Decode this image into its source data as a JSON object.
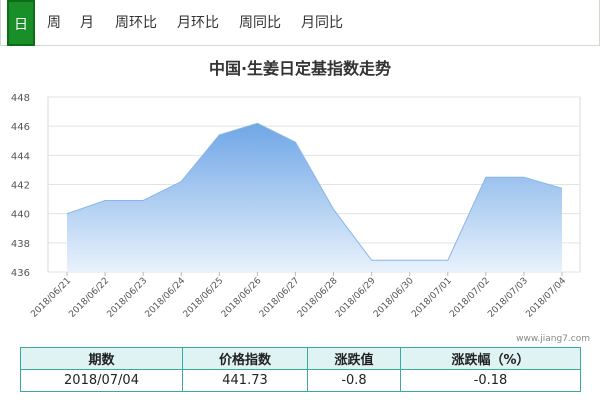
{
  "tabs": [
    {
      "label": "日",
      "active": true
    },
    {
      "label": "周",
      "active": false
    },
    {
      "label": "月",
      "active": false
    },
    {
      "label": "周环比",
      "active": false
    },
    {
      "label": "月环比",
      "active": false
    },
    {
      "label": "周同比",
      "active": false
    },
    {
      "label": "月同比",
      "active": false
    }
  ],
  "watermark": "www.jiang7.com",
  "colors": {
    "accent": "#1a8f28",
    "line": "#8ab6e6",
    "area_top": "#6fa6e6",
    "area_bottom": "#e9f2fc",
    "table_border": "#3aa9a0"
  },
  "chart_data": {
    "type": "area",
    "title": "中国·生姜日定基指数走势",
    "xlabel": "",
    "ylabel": "",
    "categories": [
      "2018/06/21",
      "2018/06/22",
      "2018/06/23",
      "2018/06/24",
      "2018/06/25",
      "2018/06/26",
      "2018/06/27",
      "2018/06/28",
      "2018/06/29",
      "2018/06/30",
      "2018/07/01",
      "2018/07/02",
      "2018/07/03",
      "2018/07/04"
    ],
    "series": [
      {
        "values": [
          440.0,
          440.9,
          440.9,
          442.2,
          445.4,
          446.2,
          444.9,
          440.3,
          436.8,
          436.8,
          436.8,
          442.5,
          442.5,
          441.73
        ]
      }
    ],
    "ylim": [
      436,
      448
    ],
    "yticks": [
      436,
      438,
      440,
      442,
      444,
      446,
      448
    ],
    "grid": true,
    "legend": "none"
  },
  "table": {
    "headers": [
      "期数",
      "价格指数",
      "涨跌值",
      "涨跌幅（%）"
    ],
    "rows": [
      [
        "2018/07/04",
        "441.73",
        "-0.8",
        "-0.18"
      ]
    ]
  }
}
